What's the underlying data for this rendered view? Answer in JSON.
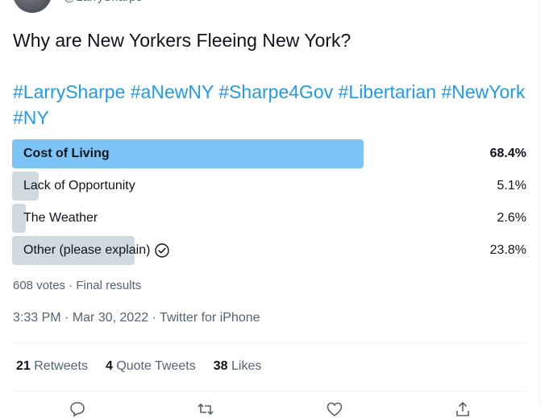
{
  "author": {
    "handle": "@LarrySharpe"
  },
  "tweet": {
    "question": "Why are New Yorkers Fleeing New York?",
    "hashtags": [
      "#LarrySharpe",
      "#aNewNY",
      "#Sharpe4Gov",
      "#Libertarian",
      "#NewYork",
      "#NY"
    ]
  },
  "poll": {
    "options": [
      {
        "label": "Cost of Living",
        "percent_text": "68.4%",
        "percent": 68.4,
        "winner": true,
        "voted": false
      },
      {
        "label": "Lack of Opportunity",
        "percent_text": "5.1%",
        "percent": 5.1,
        "winner": false,
        "voted": false
      },
      {
        "label": "The Weather",
        "percent_text": "2.6%",
        "percent": 2.6,
        "winner": false,
        "voted": false
      },
      {
        "label": "Other (please explain)",
        "percent_text": "23.8%",
        "percent": 23.8,
        "winner": false,
        "voted": true
      }
    ],
    "votes_text": "608 votes",
    "separator": "·",
    "status": "Final results"
  },
  "meta": {
    "time": "3:33 PM",
    "date": "Mar 30, 2022",
    "source": "Twitter for iPhone",
    "separator": "·"
  },
  "stats": {
    "retweets_count": "21",
    "retweets_label": "Retweets",
    "quotes_count": "4",
    "quotes_label": "Quote Tweets",
    "likes_count": "38",
    "likes_label": "Likes"
  },
  "colors": {
    "accent": "#1d9bf0",
    "winner_bar": "#7bc4f5",
    "bar": "#cfd9de",
    "muted_text": "#536471",
    "text": "#0f1419"
  }
}
